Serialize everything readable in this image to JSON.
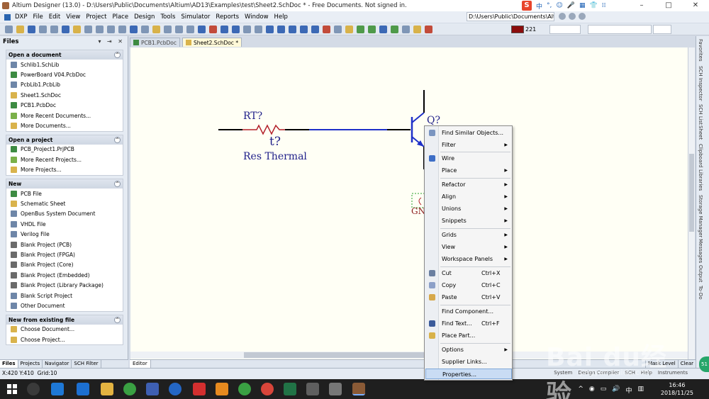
{
  "window": {
    "title": "Altium Designer (13.0) - D:\\Users\\Public\\Documents\\Altium\\AD13\\Examples\\test\\Sheet2.SchDoc * - Free Documents. Not signed in.",
    "controls": [
      "–",
      "□",
      "✕"
    ]
  },
  "menubar": {
    "items": [
      "DXP",
      "File",
      "Edit",
      "View",
      "Project",
      "Place",
      "Design",
      "Tools",
      "Simulator",
      "Reports",
      "Window",
      "Help"
    ],
    "path": "D:\\Users\\Public\\Documents\\Alti",
    "ime": {
      "logo": "S",
      "labels": [
        "中",
        "°,",
        "☺",
        "🎤",
        "▦",
        "👕",
        "⁞⁞"
      ]
    }
  },
  "toolbar": {
    "color_value": "221"
  },
  "files_panel": {
    "title": "Files",
    "header_controls": "▾ ⇥ ✕",
    "sections": [
      {
        "title": "Open a document",
        "items": [
          {
            "label": "Schlib1.SchLib",
            "icon": "doc"
          },
          {
            "label": "PowerBoard V04.PcbDoc",
            "icon": "pcb"
          },
          {
            "label": "PcbLib1.PcbLib",
            "icon": "doc"
          },
          {
            "label": "Sheet1.SchDoc",
            "icon": "sch"
          },
          {
            "label": "PCB1.PcbDoc",
            "icon": "pcb"
          },
          {
            "label": "More Recent Documents...",
            "icon": "fold"
          },
          {
            "label": "More Documents...",
            "icon": "sch"
          }
        ]
      },
      {
        "title": "Open a project",
        "items": [
          {
            "label": "PCB_Project1.PrjPCB",
            "icon": "pcb"
          },
          {
            "label": "More Recent Projects...",
            "icon": "fold"
          },
          {
            "label": "More Projects...",
            "icon": "sch"
          }
        ]
      },
      {
        "title": "New",
        "items": [
          {
            "label": "PCB File",
            "icon": "pcb"
          },
          {
            "label": "Schematic Sheet",
            "icon": "sch"
          },
          {
            "label": "OpenBus System Document",
            "icon": "doc"
          },
          {
            "label": "VHDL File",
            "icon": "doc"
          },
          {
            "label": "Verilog File",
            "icon": "doc"
          },
          {
            "label": "Blank Project (PCB)",
            "icon": "proj"
          },
          {
            "label": "Blank Project (FPGA)",
            "icon": "proj"
          },
          {
            "label": "Blank Project (Core)",
            "icon": "proj"
          },
          {
            "label": "Blank Project (Embedded)",
            "icon": "proj"
          },
          {
            "label": "Blank Project (Library Package)",
            "icon": "proj"
          },
          {
            "label": "Blank Script Project",
            "icon": "doc"
          },
          {
            "label": "Other Document",
            "icon": "doc"
          }
        ]
      },
      {
        "title": "New from existing file",
        "items": [
          {
            "label": "Choose Document...",
            "icon": "sch"
          },
          {
            "label": "Choose Project...",
            "icon": "sch"
          }
        ]
      }
    ],
    "collapse_glyph": "^",
    "tabs": [
      "Files",
      "Projects",
      "Navigator",
      "SCH Filter"
    ]
  },
  "doc_tabs": [
    {
      "label": "PCB1.PcbDoc",
      "active": false
    },
    {
      "label": "Sheet2.SchDoc *",
      "active": true
    }
  ],
  "schematic": {
    "resistor_designator": "RT?",
    "resistor_symbol": "t?",
    "resistor_comment": "Res Thermal",
    "transistor_designator": "Q?",
    "gnd_label": "GN"
  },
  "right_dock_tabs": [
    "Favorites",
    "SCH Inspector",
    "SCH List",
    "Sheet",
    "Clipboard",
    "Libraries",
    "Storage Manager",
    "Messages",
    "Output",
    "To-Do"
  ],
  "bottom_bar": {
    "editor_tab": "Editor",
    "right_items": [
      "Mask Level",
      "Clear"
    ]
  },
  "statusbar": {
    "coords": "X:420 Y:410",
    "grid": "Grid:10",
    "right_items": [
      "System",
      "Design Compiler",
      "SCH",
      "Help",
      "Instruments"
    ]
  },
  "context_menu": {
    "items": [
      {
        "label": "Find Similar Objects...",
        "icon": "find",
        "arrow": false
      },
      {
        "label": "Filter",
        "arrow": true
      },
      {
        "label": "Wire",
        "icon": "wire",
        "arrow": false
      },
      {
        "label": "Place",
        "arrow": true
      },
      {
        "label": "Refactor",
        "arrow": true
      },
      {
        "label": "Align",
        "arrow": true
      },
      {
        "label": "Unions",
        "arrow": true
      },
      {
        "label": "Snippets",
        "arrow": true
      },
      {
        "label": "Grids",
        "arrow": true
      },
      {
        "label": "View",
        "arrow": true
      },
      {
        "label": "Workspace Panels",
        "arrow": true
      },
      {
        "label": "Cut",
        "shortcut": "Ctrl+X",
        "icon": "cut"
      },
      {
        "label": "Copy",
        "shortcut": "Ctrl+C",
        "icon": "copy"
      },
      {
        "label": "Paste",
        "shortcut": "Ctrl+V",
        "icon": "paste"
      },
      {
        "label": "Find Component...",
        "arrow": false
      },
      {
        "label": "Find Text...",
        "shortcut": "Ctrl+F",
        "icon": "binoculars"
      },
      {
        "label": "Place Part...",
        "icon": "part"
      },
      {
        "label": "Options",
        "arrow": true
      },
      {
        "label": "Supplier Links...",
        "arrow": false
      },
      {
        "label": "Properties...",
        "highlight": true
      }
    ],
    "arrow_glyph": "▶"
  },
  "taskbar": {
    "clock_time": "16:46",
    "clock_date": "2018/11/25",
    "tray": [
      "^",
      "◉",
      "▭",
      "🔊",
      "中",
      "▥"
    ]
  },
  "watermark": {
    "text": "Bai du经验",
    "sub": "jingyan.baidu.com"
  },
  "badge": "51"
}
